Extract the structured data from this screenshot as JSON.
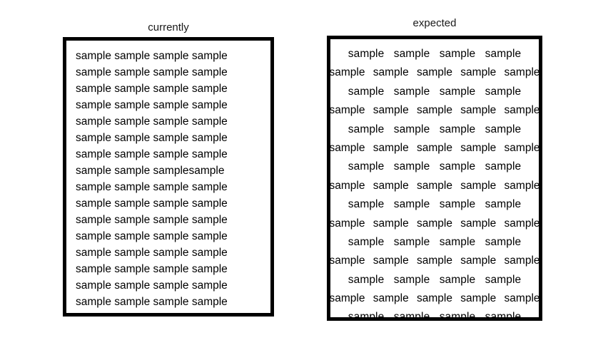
{
  "canvas": {
    "background_color": "#ffffff",
    "text_color": "#000000"
  },
  "panels": {
    "left": {
      "caption": "currently",
      "border_color": "#000000",
      "alignment": "left",
      "line_count": 16,
      "lines": [
        "sample sample sample sample",
        "sample sample sample sample",
        "sample sample sample sample",
        "sample sample sample sample",
        "sample sample sample sample",
        "sample sample sample sample",
        "sample sample sample sample",
        "sample sample samplesample",
        "sample sample sample sample",
        "sample sample sample sample",
        "sample sample sample sample",
        "sample sample sample sample",
        "sample sample sample sample",
        "sample sample sample sample",
        "sample sample sample sample",
        "sample sample sample sample"
      ]
    },
    "right": {
      "caption": "expected",
      "border_color": "#000000",
      "alignment": "justified",
      "line_count": 14,
      "lines": [
        {
          "kind": "fit",
          "text": "sample sample sample sample"
        },
        {
          "kind": "overflow",
          "text": "sample sample sample sample sample"
        },
        {
          "kind": "fit",
          "text": "sample sample sample sample"
        },
        {
          "kind": "overflow",
          "text": "sample sample sample sample sample"
        },
        {
          "kind": "fit",
          "text": "sample sample sample sample"
        },
        {
          "kind": "overflow",
          "text": "sample sample sample sample sample"
        },
        {
          "kind": "fit",
          "text": "sample sample sample sample"
        },
        {
          "kind": "overflow",
          "text": "sample sample sample sample sample"
        },
        {
          "kind": "fit",
          "text": "sample sample sample sample"
        },
        {
          "kind": "overflow",
          "text": "sample sample sample sample sample"
        },
        {
          "kind": "fit",
          "text": "sample sample sample sample"
        },
        {
          "kind": "overflow",
          "text": "sample sample sample sample sample"
        },
        {
          "kind": "fit",
          "text": "sample sample sample sample"
        },
        {
          "kind": "overflow",
          "text": "sample sample sample sample sample"
        },
        {
          "kind": "fit",
          "text": "sample sample sample sample"
        }
      ]
    }
  }
}
